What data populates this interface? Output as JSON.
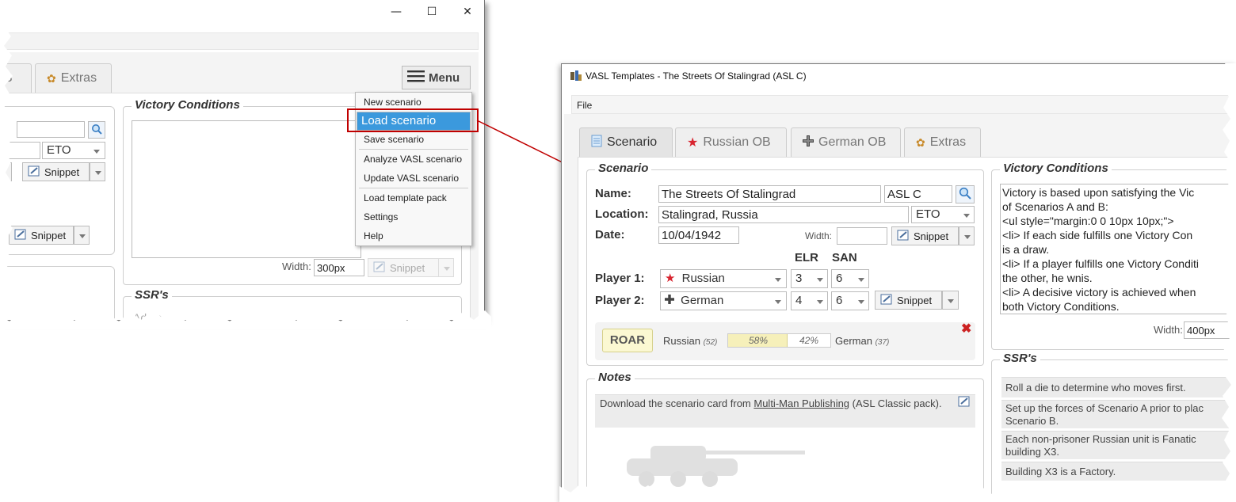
{
  "left_window": {
    "controls": {
      "minimize": "—",
      "maximize": "☐",
      "close": "✕"
    },
    "tabs": [
      {
        "label": "B"
      },
      {
        "label": "Extras"
      }
    ],
    "menu_button": "Menu",
    "date_theater": "ETO",
    "snippet_label": "Snippet",
    "victory_legend": "Victory Conditions",
    "width_label": "Width:",
    "width_value": "300px",
    "ssr_legend": "SSR's",
    "ssr_add": "Add a",
    "menu_items": [
      {
        "label": "New scenario"
      },
      {
        "label": "Load scenario"
      },
      {
        "label": "Save scenario"
      },
      {
        "label": "Analyze VASL scenario"
      },
      {
        "label": "Update VASL scenario"
      },
      {
        "label": "Load template pack"
      },
      {
        "label": "Settings"
      },
      {
        "label": "Help"
      }
    ]
  },
  "right_window": {
    "title": "VASL Templates - The Streets Of Stalingrad (ASL C)",
    "menubar": {
      "file": "File"
    },
    "tabs": [
      {
        "label": "Scenario"
      },
      {
        "label": "Russian OB"
      },
      {
        "label": "German OB"
      },
      {
        "label": "Extras"
      }
    ],
    "scenario": {
      "legend": "Scenario",
      "name_label": "Name:",
      "name_value": "The Streets Of Stalingrad",
      "id_value": "ASL C",
      "location_label": "Location:",
      "location_value": "Stalingrad, Russia",
      "theater": "ETO",
      "date_label": "Date:",
      "date_value": "10/04/1942",
      "width_label": "Width:",
      "snippet_label": "Snippet",
      "elr_header": "ELR",
      "san_header": "SAN",
      "player1_label": "Player 1:",
      "player1_nat": "Russian",
      "player1_elr": "3",
      "player1_san": "6",
      "player2_label": "Player 2:",
      "player2_nat": "German",
      "player2_elr": "4",
      "player2_san": "6"
    },
    "roar": {
      "badge": "ROAR",
      "left_name": "Russian",
      "left_count": "(52)",
      "left_pct": "58%",
      "right_pct": "42%",
      "right_name": "German",
      "right_count": "(37)",
      "left_fraction": 0.58
    },
    "notes": {
      "legend": "Notes",
      "text_before": "Download the scenario card from ",
      "link": "Multi-Man Publishing",
      "text_after": " (ASL Classic pack)."
    },
    "victory": {
      "legend": "Victory Conditions",
      "lines": [
        "Victory is based upon satisfying the Vic",
        "of Scenarios A and B:",
        "<ul style=\"margin:0 0 10px 10px;\">",
        "<li> If each side fulfills one Victory Con",
        "is a draw.",
        "<li> If a player fulfills one Victory Conditi",
        "the other, he wnis.",
        "<li> A decisive victory is achieved when",
        "both Victory Conditions."
      ],
      "width_label": "Width:",
      "width_value": "400px"
    },
    "ssrs": {
      "legend": "SSR's",
      "items": [
        "Roll a die to determine who moves first.",
        "Set up the forces of Scenario A prior to plac Scenario B.",
        "Each non-prisoner Russian unit is Fanatic building X3.",
        "Building X3 is a Factory."
      ]
    }
  },
  "colors": {
    "accent": "#3b99dd",
    "callout": "#c00000",
    "roar_bg": "#fbf8d2",
    "roar_border": "#d6d08a",
    "remove": "#cc2222"
  },
  "icons": [
    "search-icon",
    "snippet-icon",
    "hamburger-icon",
    "star-icon",
    "cross-icon",
    "extras-icon",
    "scenario-icon",
    "vasl-logo-icon",
    "edit-icon",
    "delete-icon"
  ]
}
